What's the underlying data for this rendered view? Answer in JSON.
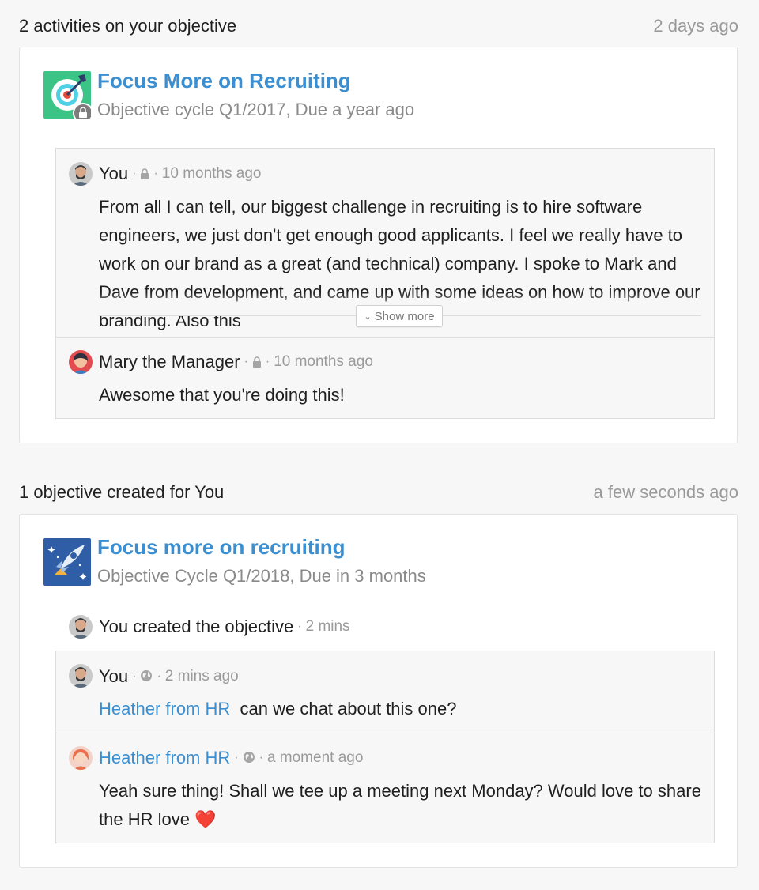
{
  "section1": {
    "header": "2 activities on your objective",
    "time": "2 days ago",
    "objective": {
      "title": "Focus More on Recruiting",
      "subtitle": "Objective cycle Q1/2017, Due a year ago"
    },
    "comments": [
      {
        "author": "You",
        "time": "10 months ago",
        "text": "From all I can tell, our biggest challenge in recruiting is to hire software engineers, we just don't get enough good applicants. I feel we really have to work on our brand as a great (and technical) company. I spoke to Mark and Dave from development, and came up with some ideas on how to improve our branding. Also this",
        "show_more": "Show more"
      },
      {
        "author": "Mary the Manager",
        "time": "10 months ago",
        "text": "Awesome that you're doing this!"
      }
    ]
  },
  "section2": {
    "header": "1 objective created for You",
    "time": "a few seconds ago",
    "objective": {
      "title": "Focus more on recruiting",
      "subtitle": "Objective Cycle Q1/2018, Due in 3 months"
    },
    "activity": {
      "text": "You created the objective",
      "time": "2 mins"
    },
    "comments": [
      {
        "author": "You",
        "time": "2 mins ago",
        "mention": "Heather from HR",
        "text": "can we chat about this one?"
      },
      {
        "author": "Heather from HR",
        "time": "a moment ago",
        "text": "Yeah sure thing! Shall we tee up a meeting next Monday? Would love to share the HR love ❤️"
      }
    ]
  }
}
